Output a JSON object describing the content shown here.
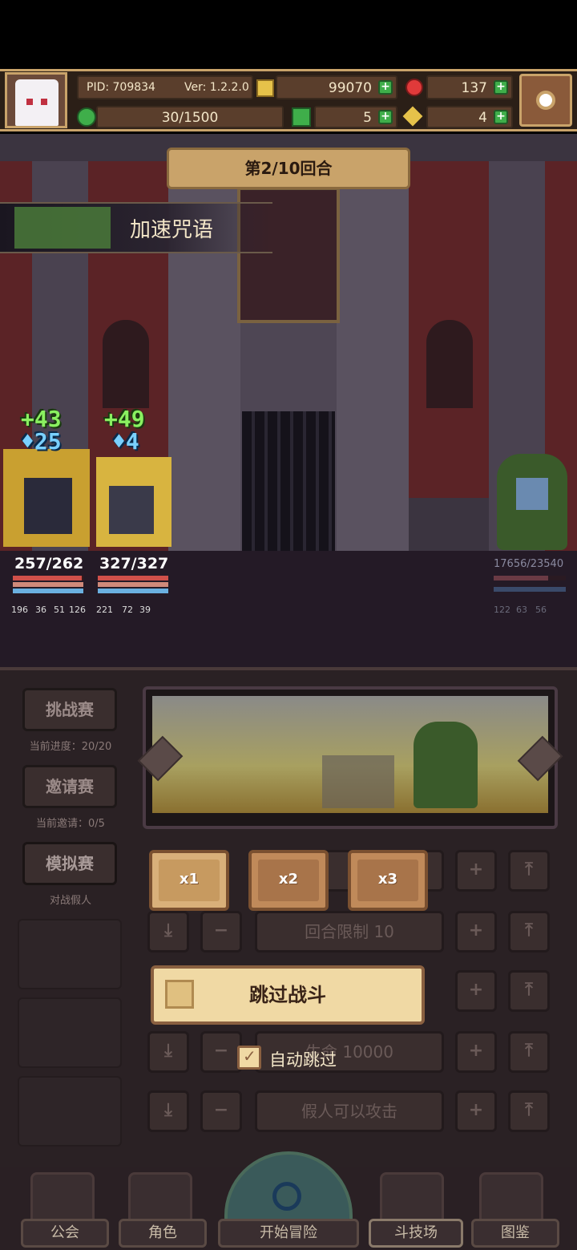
{
  "header": {
    "pid": "PID: 709834",
    "version": "Ver: 1.2.2.0",
    "gold": "99070",
    "gems": "137",
    "energy": "30/1500",
    "clover": "5",
    "key_count": "4"
  },
  "battle": {
    "round": "第2/10回合",
    "skill_name": "加速咒语",
    "heroes": [
      {
        "buff_heal": "43",
        "buff_shield": "25",
        "hp": "257/262",
        "stats": [
          "196",
          "36",
          "51",
          "126"
        ],
        "hp_fraction": 0.98
      },
      {
        "buff_heal": "49",
        "buff_shield": "4",
        "hp": "327/327",
        "stats": [
          "221",
          "72",
          "39"
        ],
        "hp_fraction": 1.0
      }
    ],
    "enemy": {
      "hp": "17656/23540",
      "stats": [
        "122",
        "63",
        "56"
      ],
      "hp_fraction": 0.75
    }
  },
  "sidebar": {
    "items": [
      {
        "label": "挑战赛",
        "note": "当前进度：20/20"
      },
      {
        "label": "邀请赛",
        "note": "当前邀请：0/5"
      },
      {
        "label": "模拟赛",
        "note": "对战假人"
      }
    ]
  },
  "controls": {
    "speeds": [
      "x1",
      "x2",
      "x3"
    ],
    "round_limit": "回合限制 10",
    "hp_field": "生命 10000",
    "dummy_attack": "假人可以攻击",
    "skip_label": "跳过战斗",
    "auto_skip_label": "自动跳过",
    "auto_skip_checked": true
  },
  "nav": {
    "guild": "公会",
    "character": "角色",
    "adventure": "开始冒险",
    "arena": "斗技场",
    "codex": "图鉴"
  },
  "colors": {
    "header_border": "#c9a36a",
    "green_button": "#3fae4a",
    "hp_red": "#d0504a",
    "mp_blue": "#6ab0e0",
    "skip_button": "#f0d9a4"
  }
}
